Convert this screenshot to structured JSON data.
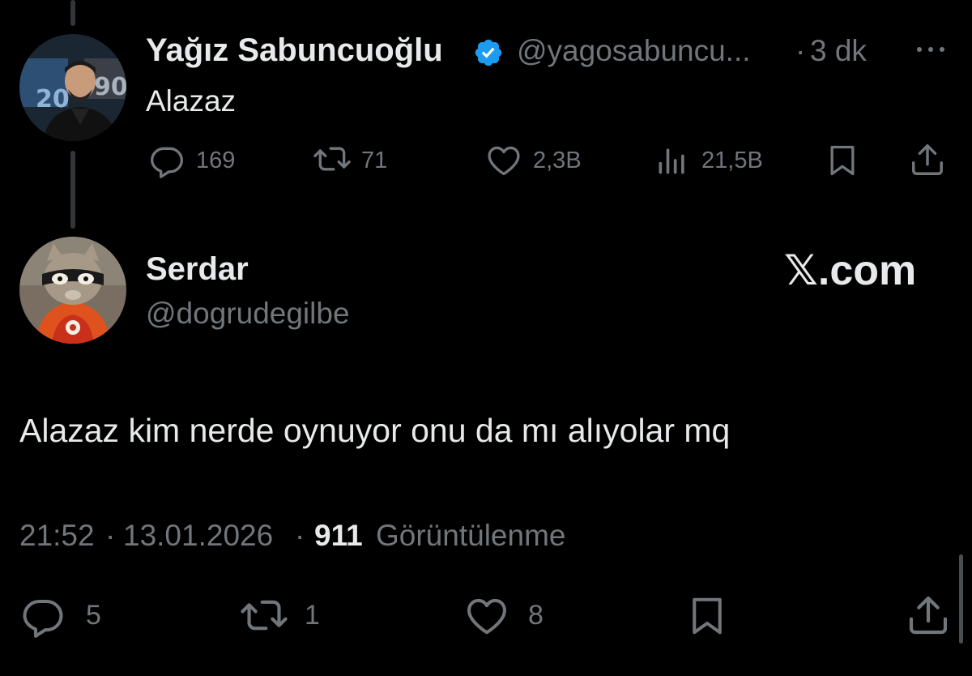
{
  "parent_tweet": {
    "display_name": "Yağız Sabuncuoğlu",
    "verified": true,
    "handle": "@yagosabuncu...",
    "separator": "·",
    "time_ago": "3 dk",
    "text": "Alazaz",
    "actions": {
      "replies": "169",
      "retweets": "71",
      "likes": "2,3B",
      "views": "21,5B"
    }
  },
  "main_tweet": {
    "display_name": "Serdar",
    "handle": "@dogrudegilbe",
    "watermark": "𝕏.com",
    "text": "Alazaz kim nerde oynuyor onu da mı alıyolar mq",
    "time": "21:52",
    "date": "13.01.2026",
    "separator": "·",
    "views_count": "911",
    "views_label": "Görüntülenme",
    "actions": {
      "replies": "5",
      "retweets": "1",
      "likes": "8"
    }
  },
  "colors": {
    "background": "#000000",
    "text": "#e7e9ea",
    "muted": "#71767b",
    "verified_blue": "#1d9bf0",
    "thread_line": "#333639"
  },
  "icons": [
    "more-icon",
    "verified-badge-icon",
    "reply-icon",
    "retweet-icon",
    "like-icon",
    "views-icon",
    "bookmark-icon",
    "share-icon"
  ]
}
